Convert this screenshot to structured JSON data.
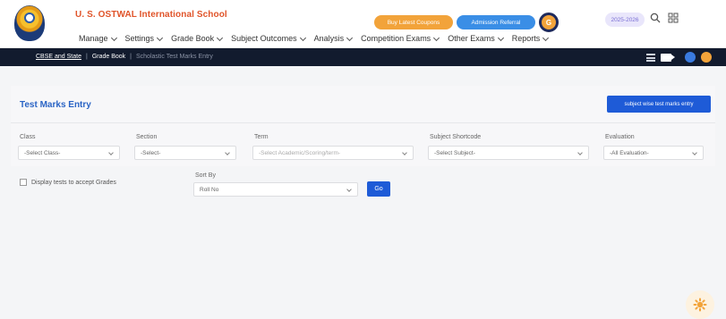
{
  "header": {
    "school_name": "U. S. OSTWAL International School",
    "btn_orange": "Buy Latest Coupons",
    "btn_blue": "Admission Referral",
    "year": "2025-2026"
  },
  "nav": [
    {
      "label": "Manage"
    },
    {
      "label": "Settings"
    },
    {
      "label": "Grade Book"
    },
    {
      "label": "Subject Outcomes"
    },
    {
      "label": "Analysis"
    },
    {
      "label": "Competition Exams"
    },
    {
      "label": "Other Exams"
    },
    {
      "label": "Reports"
    }
  ],
  "breadcrumb": {
    "item1": "CBSE and State",
    "item2": "Grade Book",
    "item3": "Scholastic Test Marks Entry"
  },
  "main": {
    "title": "Test Marks Entry",
    "subject_wise_btn": "subject wise test marks entry"
  },
  "filters": {
    "class": {
      "label": "Class",
      "value": "-Select Class-"
    },
    "section": {
      "label": "Section",
      "value": "-Select-"
    },
    "term": {
      "label": "Term",
      "value": "-Select Academic/Scoring/term-"
    },
    "subject": {
      "label": "Subject Shortcode",
      "value": "-Select Subject-"
    },
    "evaluation": {
      "label": "Evaluation",
      "value": "-All Evaluation-"
    }
  },
  "options": {
    "display_tests_label": "Display tests to accept Grades",
    "sort_by_label": "Sort By",
    "sort_by_value": "Roll No",
    "go_label": "Go"
  },
  "colors": {
    "brand_blue": "#1e5bd7",
    "title_blue": "#2a64c5",
    "school_orange": "#e0542a",
    "dark_bar": "#121b2e"
  }
}
